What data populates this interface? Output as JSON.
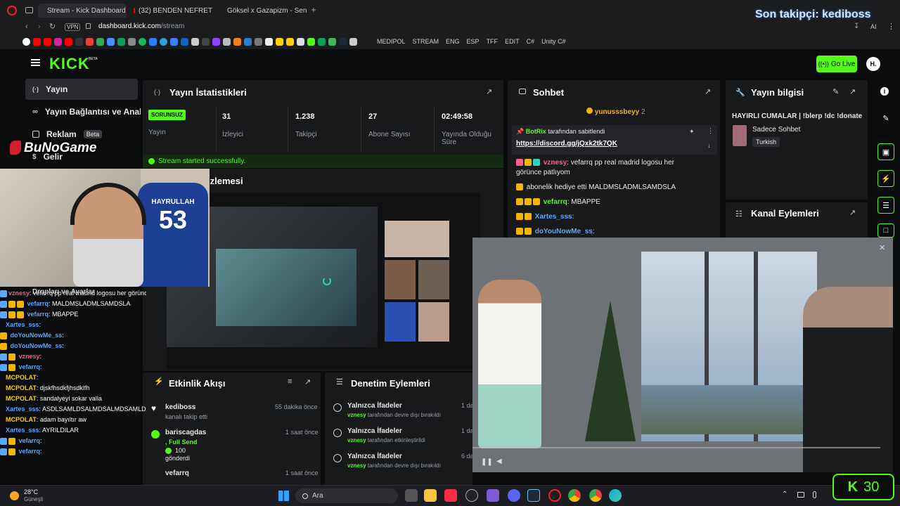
{
  "browser": {
    "tabs": [
      {
        "label": "Stream - Kick Dashboard",
        "active": true
      },
      {
        "label": "(32) BENDEN NEFRET",
        "active": false
      },
      {
        "label": "Göksel x Gazapizm - Sen O",
        "active": false
      }
    ],
    "vpn": "VPN",
    "url_host": "dashboard.kick.com",
    "url_path": "/stream",
    "bookmarks": [
      "MEDIPOL",
      "STREAM",
      "ENG",
      "ESP",
      "TFF",
      "EDIT",
      "C#",
      "Unity C#"
    ]
  },
  "header": {
    "logo": "KICK",
    "logo_badge": "BETA",
    "go_live": "Go Live",
    "avatar": "H.",
    "follower_overlay": "Son takipçi: kediboss"
  },
  "sidebar": {
    "items": [
      {
        "label": "Yayın",
        "icon": "broadcast-icon"
      },
      {
        "label": "Yayın Bağlantısı ve Anahtar",
        "icon": "link-icon"
      },
      {
        "label": "Reklam",
        "badge": "Beta",
        "icon": "ad-icon"
      },
      {
        "label": "Gelir",
        "icon": "money-icon"
      }
    ]
  },
  "stats": {
    "title": "Yayın İstatistikleri",
    "status": "SORUNSUZ",
    "status_label": "Yayın",
    "items": [
      {
        "value": "31",
        "label": "İzleyici"
      },
      {
        "value": "1.238",
        "label": "Takipçi"
      },
      {
        "value": "27",
        "label": "Abone Sayısı"
      },
      {
        "value": "02:49:58",
        "label": "Yayında Olduğu Süre"
      }
    ],
    "success": "Stream started successfully."
  },
  "preview": {
    "title_fragment": "izlemesi"
  },
  "chat": {
    "title": "Sohbet",
    "top_user": "yunusssbeyy",
    "top_count": "2",
    "pinned_by": "BotRix",
    "pinned_text": "tarafından sabitlendi",
    "pinned_link": "https://discord.gg/jQxk2tk7QK",
    "messages": [
      {
        "user": "vznesy",
        "text": ": vefarrq pp real madrid logosu her",
        "color": "#ff5c8a"
      },
      {
        "user": "",
        "text": "görünce patlıyom",
        "color": "#ffffff"
      },
      {
        "user": "",
        "text": "abonelik hediye etti  MALDMSLADMLSAMDSLA",
        "color": "#ffffff"
      },
      {
        "user": "vefarrq",
        "text": ": MBAPPE",
        "color": "#53fc18"
      },
      {
        "user": "Xartes_sss",
        "text": ":",
        "color": "#5aa9ff"
      },
      {
        "user": "doYouNowMe_ss",
        "text": ":",
        "color": "#5aa9ff"
      }
    ]
  },
  "info": {
    "title": "Yayın bilgisi",
    "stream_title": "HAYIRLI CUMALAR | !blerp !dc !donate",
    "category": "Sadece Sohbet",
    "language": "Turkish"
  },
  "channel_actions": {
    "title": "Kanal Eylemleri"
  },
  "activity": {
    "title": "Etkinlik Akışı",
    "items": [
      {
        "user": "kediboss",
        "time": "55 dakika önce",
        "desc": "kanalı takip etti",
        "extra": ""
      },
      {
        "user": "bariscagdas",
        "time": "1 saat önce",
        "desc": ", Full Send",
        "extra": "100",
        "extra2": "gönderdi"
      },
      {
        "user": "vefarrq",
        "time": "1 saat önce",
        "desc": "",
        "extra": ""
      }
    ]
  },
  "moderation": {
    "title": "Denetim Eylemleri",
    "items": [
      {
        "title": "Yalnızca İfadeler",
        "user": "vznesy",
        "desc": "tarafından devre dışı bırakıldı",
        "time": "1 da"
      },
      {
        "title": "Yalnızca İfadeler",
        "user": "vznesy",
        "desc": "tarafından etkinleştirildi",
        "time": "1 da"
      },
      {
        "title": "Yalnızca İfadeler",
        "user": "vznesy",
        "desc": "tarafından devre dışı bırakıldı",
        "time": "6 da"
      }
    ]
  },
  "overlay_chat": {
    "header": "Dropları ve Ayarlar",
    "lines": [
      {
        "user": "vznesy",
        "text": ": vefarrq pp real madrid logosu her görünce patlıyom",
        "color": "#ff5c8a"
      },
      {
        "user": "vefarrq",
        "text": ": MALDMSLADMLSAMDSLA",
        "color": "#5aa9ff"
      },
      {
        "user": "vefarrq",
        "text": ": MBAPPE",
        "color": "#5aa9ff"
      },
      {
        "user": "Xartes_sss",
        "text": ":",
        "color": "#5aa9ff"
      },
      {
        "user": "doYouNowMe_ss",
        "text": ":",
        "color": "#5aa9ff"
      },
      {
        "user": "doYouNowMe_ss",
        "text": ":",
        "color": "#5aa9ff"
      },
      {
        "user": "vznesy",
        "text": ":",
        "color": "#ff5c8a"
      },
      {
        "user": "vefarrq",
        "text": ":",
        "color": "#5aa9ff"
      },
      {
        "user": "MCPOLAT",
        "text": ":",
        "color": "#ffd400"
      },
      {
        "user": "MCPOLAT",
        "text": ": djskfhsdkfjhsdklfh",
        "color": "#ffd400"
      },
      {
        "user": "MCPOLAT",
        "text": ": sandalyeyi sokar valla",
        "color": "#ffd400"
      },
      {
        "user": "Xartes_sss",
        "text": ": ASDLSAMLDSALMDSALMDSAMLDALM",
        "color": "#5aa9ff"
      },
      {
        "user": "MCPOLAT",
        "text": ": adam bayıltır aw",
        "color": "#ffd400"
      },
      {
        "user": "Xartes_sss",
        "text": ": AYRILDILAR",
        "color": "#5aa9ff"
      },
      {
        "user": "vefarrq",
        "text": ":",
        "color": "#5aa9ff"
      },
      {
        "user": "vefarrq",
        "text": ":",
        "color": "#5aa9ff"
      }
    ]
  },
  "watermark": "BuNoGame",
  "webcam": {
    "jersey_name": "HAYRULLAH",
    "jersey_number": "53"
  },
  "taskbar": {
    "weather_temp": "28°C",
    "weather_desc": "Güneşli",
    "search": "Ara",
    "kick_counter": "30"
  },
  "colors": {
    "kick_green": "#53fc18",
    "panel": "#18191b",
    "bg": "#0b0c0d"
  }
}
